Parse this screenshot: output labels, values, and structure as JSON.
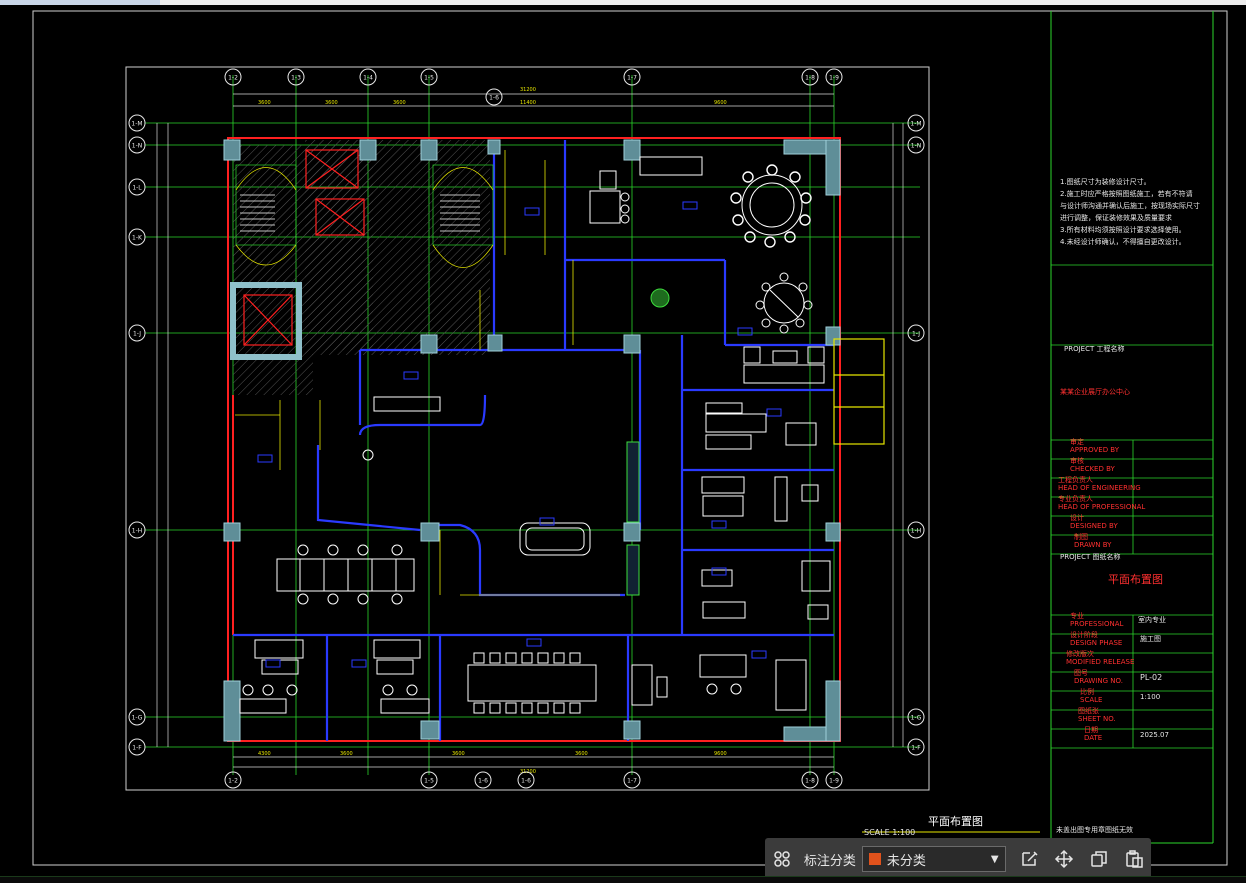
{
  "grid_labels_top": [
    "1-2",
    "1-3",
    "1-4",
    "1-5",
    "1-7",
    "1-8",
    "1-9"
  ],
  "grid_labels_bottom": [
    "1-2",
    "1-5",
    "1-6",
    "1-6",
    "1-7",
    "1-8",
    "1-9"
  ],
  "grid_label_top_sub": "1-6",
  "grid_labels_left": [
    "1-M",
    "1-N",
    "1-L",
    "1-K",
    "1-J",
    "1-H",
    "1-G",
    "1-F"
  ],
  "grid_labels_right": [
    "1-M",
    "1-N",
    "1-J",
    "1-H",
    "1-G",
    "1-F"
  ],
  "plan_title": "平面布置图",
  "plan_scale": "SCALE 1:100",
  "notes": [
    "1.图纸尺寸为装修设计尺寸。",
    "2.施工时应严格按照图纸施工，若有不符请",
    "  与设计师沟通并确认后施工，按现场实际尺寸",
    "  进行调整，保证装修效果及质量要求",
    "3.所有材料均须按照设计要求选择使用。",
    "4.未经设计师确认，不得擅自更改设计。"
  ],
  "title_block": {
    "project_label": "PROJECT 工程名称",
    "project_name": "某某企业展厅办公中心",
    "approved_cn": "审定",
    "approved_en": "APPROVED BY",
    "checked_cn": "审核",
    "checked_en": "CHECKED BY",
    "head_eng_cn": "工程负责人",
    "head_eng_en": "HEAD OF ENGINEERING",
    "head_prof_cn": "专业负责人",
    "head_prof_en": "HEAD OF PROFESSIONAL",
    "designed_cn": "设计",
    "designed_en": "DESIGNED BY",
    "drawn_cn": "制图",
    "drawn_en": "DRAWN BY",
    "project2_label": "PROJECT 图纸名称",
    "drawing_name": "平面布置图",
    "professional_cn": "专业",
    "professional_en": "PROFESSIONAL",
    "professional_val": "室内专业",
    "phase_cn": "设计阶段",
    "phase_en": "DESIGN PHASE",
    "phase_val": "施工图",
    "release_cn": "修改版次",
    "release_en": "MODIFIED RELEASE",
    "drawing_no_cn": "图号",
    "drawing_no_en": "DRAWING NO.",
    "drawing_no_val": "PL-02",
    "scale_cn": "比例",
    "scale_en": "SCALE",
    "scale_val": "1:100",
    "sheet_cn": "图纸张",
    "sheet_en": "SHEET NO.",
    "date_cn": "日期",
    "date_en": "DATE",
    "date_val": "2025.07",
    "bottom_note": "未盖出图专用章图纸无效"
  },
  "toolbar": {
    "grid_icon": "grid-view-icon",
    "label": "标注分类",
    "select_value": "未分类",
    "select_color": "#e0521c",
    "edit_icon": "edit-icon",
    "move_icon": "move-icon",
    "copy_icon": "copy-icon",
    "paste_icon": "paste-icon"
  },
  "colors": {
    "background": "#000000",
    "wall_red": "#ff2020",
    "column_cyan": "#6aa7b3",
    "furniture_white": "#ffffff",
    "dim_yellow": "#e6e600",
    "grid_green": "#2bd62b",
    "interior_blue": "#2a3aff",
    "frame_white": "#d8d8d8"
  }
}
